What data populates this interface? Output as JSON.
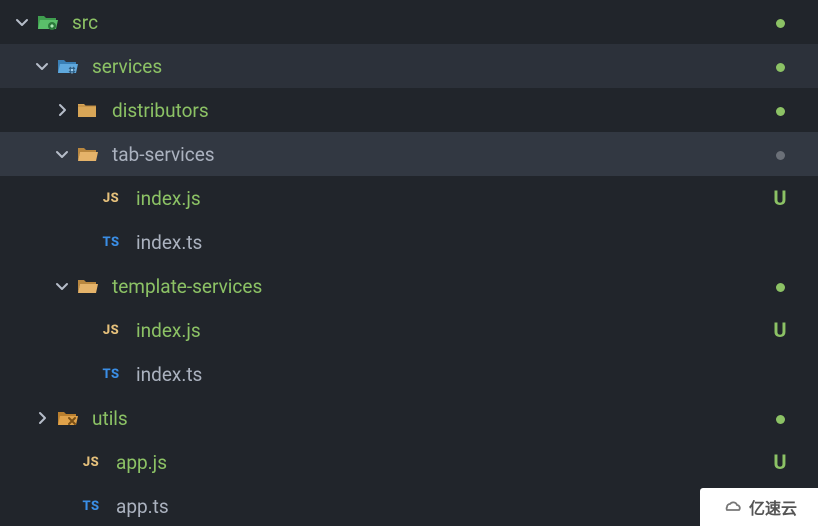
{
  "tree": {
    "src": {
      "label": "src",
      "status": "dot-green",
      "expanded": true
    },
    "services": {
      "label": "services",
      "status": "dot-green",
      "expanded": true
    },
    "distributors": {
      "label": "distributors",
      "status": "dot-green",
      "expanded": false
    },
    "tab_services": {
      "label": "tab-services",
      "status": "dot-grey",
      "expanded": true
    },
    "tab_index_js": {
      "label": "index.js",
      "status": "U"
    },
    "tab_index_ts": {
      "label": "index.ts",
      "status": ""
    },
    "template_services": {
      "label": "template-services",
      "status": "dot-green",
      "expanded": true
    },
    "tpl_index_js": {
      "label": "index.js",
      "status": "U"
    },
    "tpl_index_ts": {
      "label": "index.ts",
      "status": ""
    },
    "utils": {
      "label": "utils",
      "status": "dot-green",
      "expanded": false
    },
    "app_js": {
      "label": "app.js",
      "status": "U"
    },
    "app_ts": {
      "label": "app.ts",
      "status": ""
    }
  },
  "icons": {
    "js": "JS",
    "ts": "TS"
  },
  "watermark": {
    "text": "亿速云"
  }
}
